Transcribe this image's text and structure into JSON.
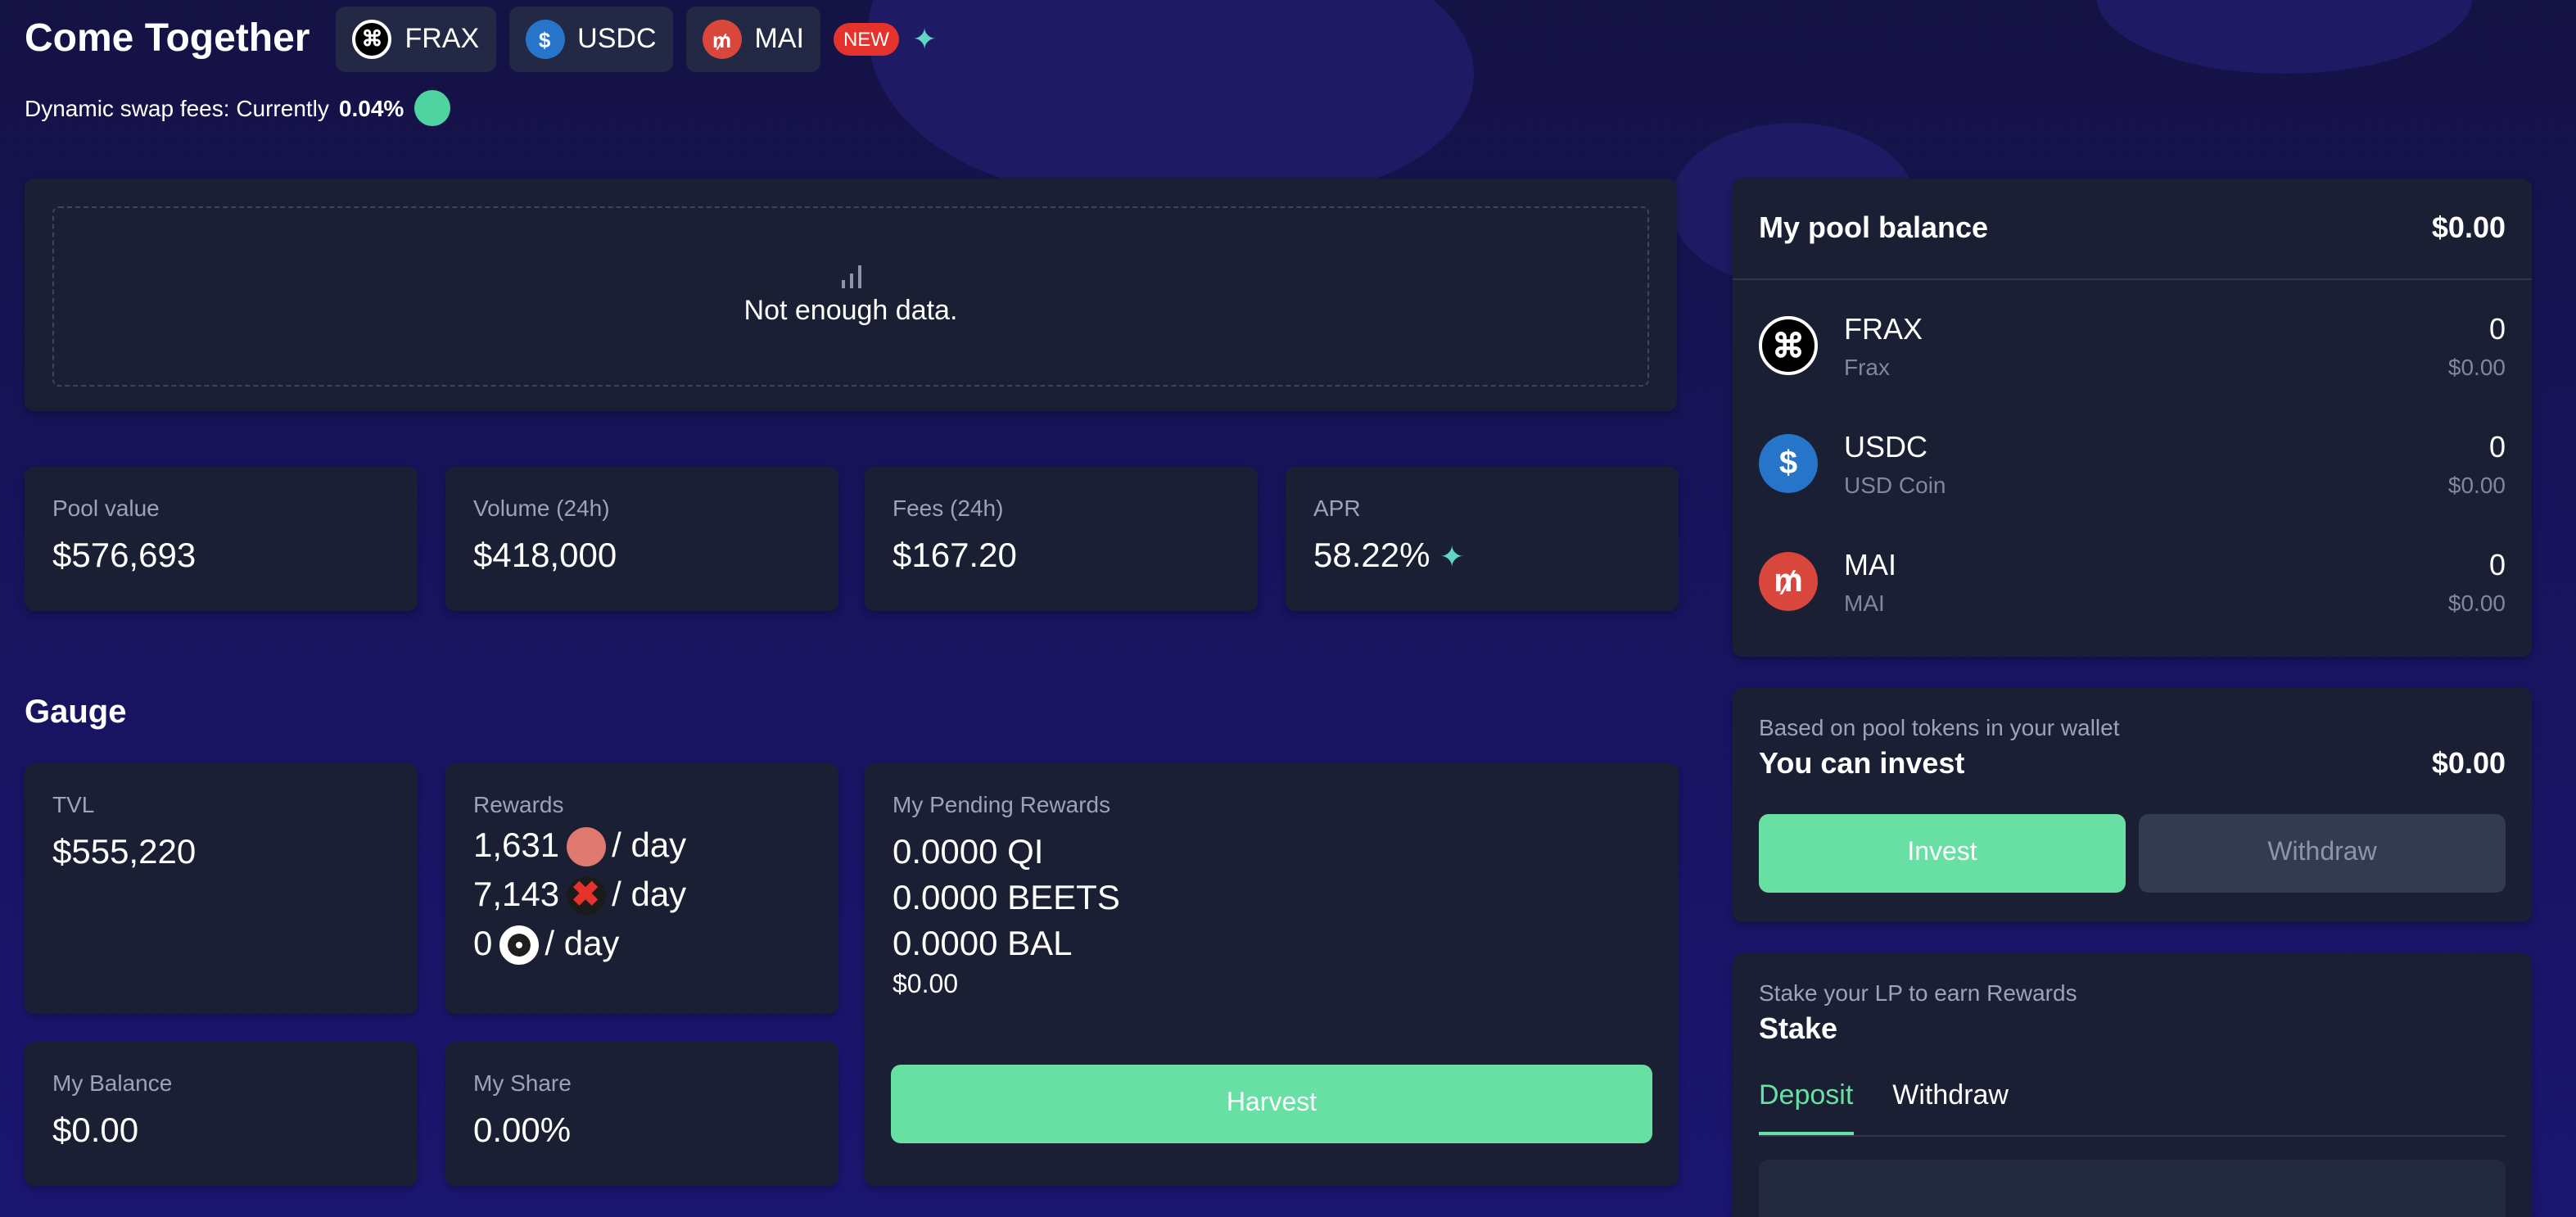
{
  "pool": {
    "title": "Come Together",
    "tokens": [
      {
        "symbol": "FRAX",
        "icon": "frax-icon"
      },
      {
        "symbol": "USDC",
        "icon": "usdc-icon"
      },
      {
        "symbol": "MAI",
        "icon": "mai-icon"
      }
    ],
    "new_badge": "NEW",
    "fees_prefix": "Dynamic swap fees: Currently",
    "fees_value": "0.04%"
  },
  "chart": {
    "empty_text": "Not enough data."
  },
  "stats": [
    {
      "label": "Pool value",
      "value": "$576,693"
    },
    {
      "label": "Volume (24h)",
      "value": "$418,000"
    },
    {
      "label": "Fees (24h)",
      "value": "$167.20"
    },
    {
      "label": "APR",
      "value": "58.22%"
    }
  ],
  "gauge": {
    "heading": "Gauge",
    "tvl_label": "TVL",
    "tvl_value": "$555,220",
    "rewards_label": "Rewards",
    "rewards": [
      {
        "amount": "1,631",
        "per": "/ day",
        "icon": "qi-token-icon"
      },
      {
        "amount": "7,143",
        "per": "/ day",
        "icon": "beets-token-icon"
      },
      {
        "amount": "0",
        "per": "/ day",
        "icon": "bal-token-icon"
      }
    ],
    "pending_label": "My Pending Rewards",
    "pending": [
      "0.0000 QI",
      "0.0000 BEETS",
      "0.0000 BAL"
    ],
    "pending_usd": "$0.00",
    "harvest_label": "Harvest",
    "balance_label": "My Balance",
    "balance_value": "$0.00",
    "share_label": "My Share",
    "share_value": "0.00%"
  },
  "pool_balance": {
    "title": "My pool balance",
    "total": "$0.00",
    "rows": [
      {
        "symbol": "FRAX",
        "name": "Frax",
        "amount": "0",
        "usd": "$0.00"
      },
      {
        "symbol": "USDC",
        "name": "USD Coin",
        "amount": "0",
        "usd": "$0.00"
      },
      {
        "symbol": "MAI",
        "name": "MAI",
        "amount": "0",
        "usd": "$0.00"
      }
    ]
  },
  "invest": {
    "hint": "Based on pool tokens in your wallet",
    "label": "You can invest",
    "value": "$0.00",
    "invest_btn": "Invest",
    "withdraw_btn": "Withdraw"
  },
  "stake": {
    "hint": "Stake your LP to earn Rewards",
    "title": "Stake",
    "tabs": [
      "Deposit",
      "Withdraw"
    ],
    "active_tab": "Deposit"
  },
  "colors": {
    "accent": "#68e0a4",
    "background": "#17135a",
    "card": "#1a1f34",
    "new_badge": "#e5322d"
  }
}
